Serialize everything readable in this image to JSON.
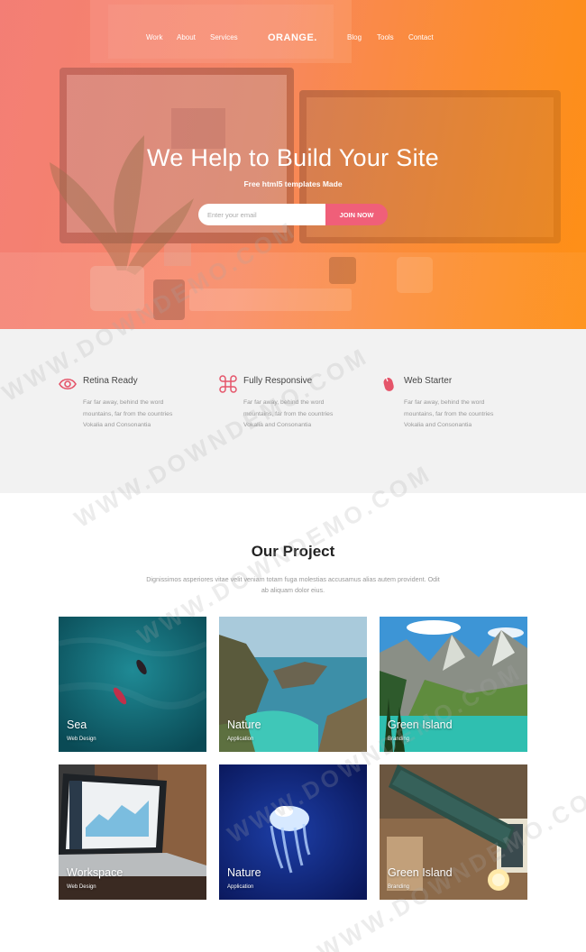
{
  "nav": {
    "left": [
      "Work",
      "About",
      "Services"
    ],
    "brand": "ORANGE.",
    "right": [
      "Blog",
      "Tools",
      "Contact"
    ]
  },
  "hero": {
    "title": "We Help to Build Your Site",
    "subtitle": "Free html5 templates Made",
    "email_placeholder": "Enter your email",
    "join_label": "JOIN NOW"
  },
  "features": [
    {
      "icon": "eye-icon",
      "title": "Retina Ready",
      "desc": "Far far away, behind the word mountains, far from the countries Vokalia and Consonantia"
    },
    {
      "icon": "command-icon",
      "title": "Fully Responsive",
      "desc": "Far far away, behind the word mountains, far from the countries Vokalia and Consonantia"
    },
    {
      "icon": "mouse-icon",
      "title": "Web Starter",
      "desc": "Far far away, behind the word mountains, far from the countries Vokalia and Consonantia"
    }
  ],
  "projects": {
    "title": "Our Project",
    "desc": "Dignissimos asperiores vitae velit veniam totam fuga molestias accusamus alias autem provident. Odit ab aliquam dolor eius.",
    "items": [
      {
        "name": "Sea",
        "category": "Web Design"
      },
      {
        "name": "Nature",
        "category": "Application"
      },
      {
        "name": "Green Island",
        "category": "Branding"
      },
      {
        "name": "Workspace",
        "category": "Web Design"
      },
      {
        "name": "Nature",
        "category": "Application"
      },
      {
        "name": "Green Island",
        "category": "Branding"
      }
    ]
  },
  "watermark": "WWW.DOWNDEMO.COM",
  "colors": {
    "accent": "#f05f79",
    "orange": "#fd8f14",
    "feature_icon": "#e5556a"
  }
}
